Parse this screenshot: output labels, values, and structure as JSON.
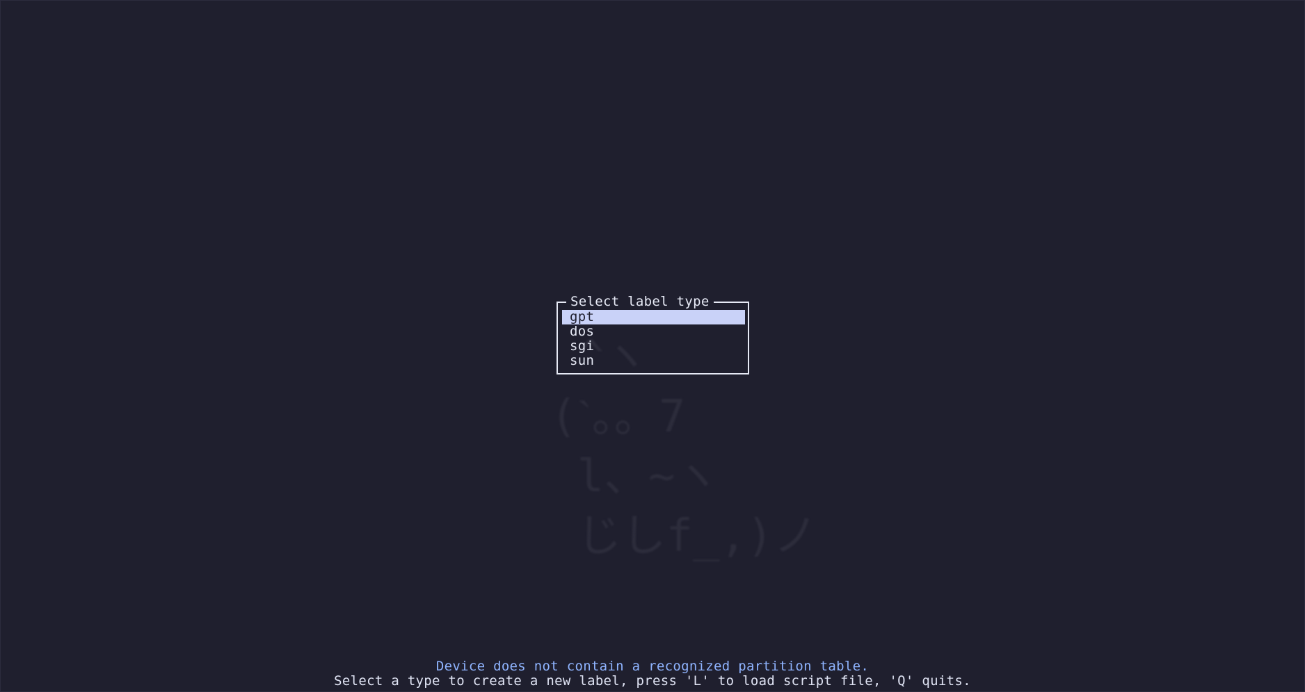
{
  "dialog": {
    "title": "Select label type",
    "options": [
      {
        "label": "gpt",
        "selected": true
      },
      {
        "label": "dos",
        "selected": false
      },
      {
        "label": "sgi",
        "selected": false
      },
      {
        "label": "sun",
        "selected": false
      }
    ]
  },
  "status": {
    "message": "Device does not contain a recognized partition table.",
    "hint": "Select a type to create a new label, press 'L' to load script file, 'Q' quits."
  },
  "colors": {
    "background": "#1f1f2e",
    "selection": "#c9d2f8",
    "message": "#8fb4ff",
    "text": "#dfe3f3"
  }
}
